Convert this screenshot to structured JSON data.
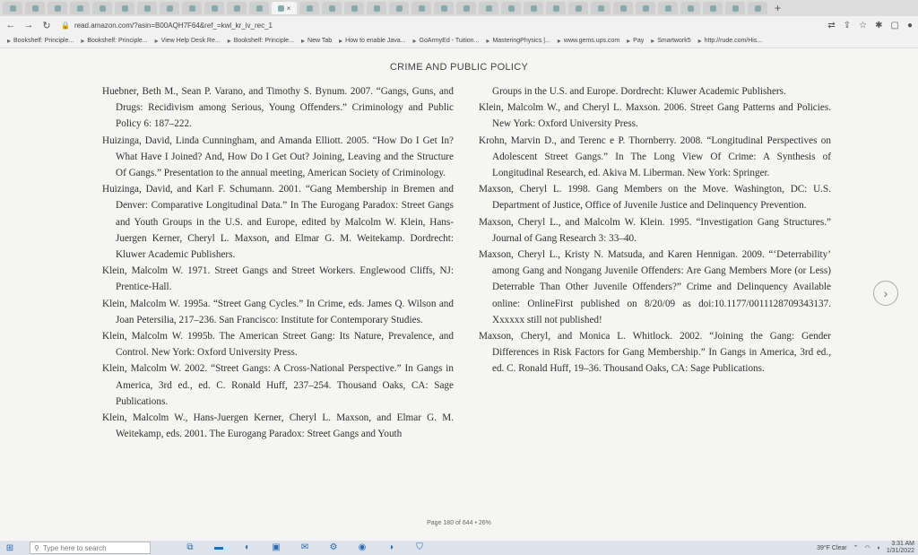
{
  "browser": {
    "tabs": [
      "",
      "",
      "",
      "",
      "",
      "",
      "",
      "",
      "",
      "",
      "",
      "",
      "",
      "",
      "",
      "",
      "",
      "",
      "",
      "",
      "",
      "",
      "",
      "",
      "",
      "",
      "",
      "",
      "",
      "",
      "",
      "",
      "",
      ""
    ],
    "active_tab_close": "×",
    "new_tab": "+",
    "url": "read.amazon.com/?asin=B00AQH7F64&ref_=kwl_kr_iv_rec_1",
    "bookmarks": [
      "Bookshelf: Principle...",
      "Bookshelf: Principle...",
      "View Help Desk Re...",
      "Bookshelf: Principle...",
      "New Tab",
      "How to enable Java...",
      "GoArmyEd - Tuition...",
      "MasteringPhysics |...",
      "www.gems.ups.com",
      "Pay",
      "Smartwork5",
      "http://rude.com/His..."
    ]
  },
  "reader": {
    "header": "CRIME AND PUBLIC POLICY",
    "left_column": [
      {
        "text": "Huebner, Beth M., Sean P. Varano, and Timothy S. Bynum. 2007. “Gangs, Guns, and Drugs: Recidivism among Serious, Young Offenders.” Criminology and Public Policy 6: 187–222."
      },
      {
        "text": "Huizinga, David, Linda Cunningham, and Amanda Elliott. 2005. “How Do I Get In? What Have I Joined? And, How Do I Get Out? Joining, Leaving and the Structure Of Gangs.” Presentation to the annual meeting, American Society of Criminology."
      },
      {
        "text": "Huizinga, David, and Karl F. Schumann. 2001. “Gang Membership in Bremen and Denver: Comparative Longitudinal Data.” In The Eurogang Paradox: Street Gangs and Youth Groups in the U.S. and Europe, edited by Malcolm W. Klein, Hans-Juergen Kerner, Cheryl L. Maxson, and Elmar G. M. Weitekamp. Dordrecht: Kluwer Academic Publishers."
      },
      {
        "text": "Klein, Malcolm W. 1971. Street Gangs and Street Workers. Englewood Cliffs, NJ: Prentice-Hall."
      },
      {
        "text": "Klein, Malcolm W. 1995a. “Street Gang Cycles.” In Crime, eds. James Q. Wilson and Joan Petersilia, 217–236. San Francisco: Institute for Contemporary Studies."
      },
      {
        "text": "Klein, Malcolm W. 1995b. The American Street Gang: Its Nature, Prevalence, and Control. New York: Oxford University Press."
      },
      {
        "text": "Klein, Malcolm W. 2002. “Street Gangs: A Cross-National Perspective.” In Gangs in America, 3rd ed., ed. C. Ronald Huff, 237–254. Thousand Oaks, CA: Sage Publications."
      },
      {
        "text": "Klein, Malcolm W., Hans-Juergen Kerner, Cheryl L. Maxson, and Elmar G. M. Weitekamp, eds. 2001. The Eurogang Paradox: Street Gangs and Youth"
      }
    ],
    "right_column": [
      {
        "text": "Groups in the U.S. and Europe. Dordrecht: Kluwer Academic Publishers.",
        "cont": true
      },
      {
        "text": "Klein, Malcolm W., and Cheryl L. Maxson. 2006. Street Gang Patterns and Policies. New York: Oxford University Press."
      },
      {
        "text": "Krohn, Marvin D., and Terenc e P. Thornberry. 2008. “Longitudinal Perspectives on Adolescent Street Gangs.” In The Long View Of Crime: A Synthesis of Longitudinal Research, ed. Akiva M. Liberman. New York: Springer."
      },
      {
        "text": "Maxson, Cheryl L. 1998. Gang Members on the Move. Washington, DC: U.S. Department of Justice, Office of Juvenile Justice and Delinquency Prevention."
      },
      {
        "text": "Maxson, Cheryl L., and Malcolm W. Klein. 1995. “Investigation Gang Structures.” Journal of Gang Research 3: 33–40."
      },
      {
        "text": "Maxson, Cheryl L., Kristy N. Matsuda, and Karen Hennigan. 2009. “‘Deterrability’ among Gang and Nongang Juvenile Offenders: Are Gang Members More (or Less) Deterrable Than Other Juvenile Offenders?” Crime and Delinquency Available online: OnlineFirst published on 8/20/09 as doi:10.1177/0011128709343137. Xxxxxx still not published!"
      },
      {
        "text": "Maxson, Cheryl, and Monica L. Whitlock. 2002. “Joining the Gang: Gender Differences in Risk Factors for Gang Membership.” In Gangs in America, 3rd ed., ed. C. Ronald Huff, 19–36. Thousand Oaks, CA: Sage Publications."
      }
    ],
    "page_indicator": "Page 180 of 644 • 26%",
    "next_arrow": "›"
  },
  "taskbar": {
    "search_placeholder": "Type here to search",
    "weather": "39°F Clear",
    "time": "3:31 AM",
    "date": "1/31/2022"
  }
}
